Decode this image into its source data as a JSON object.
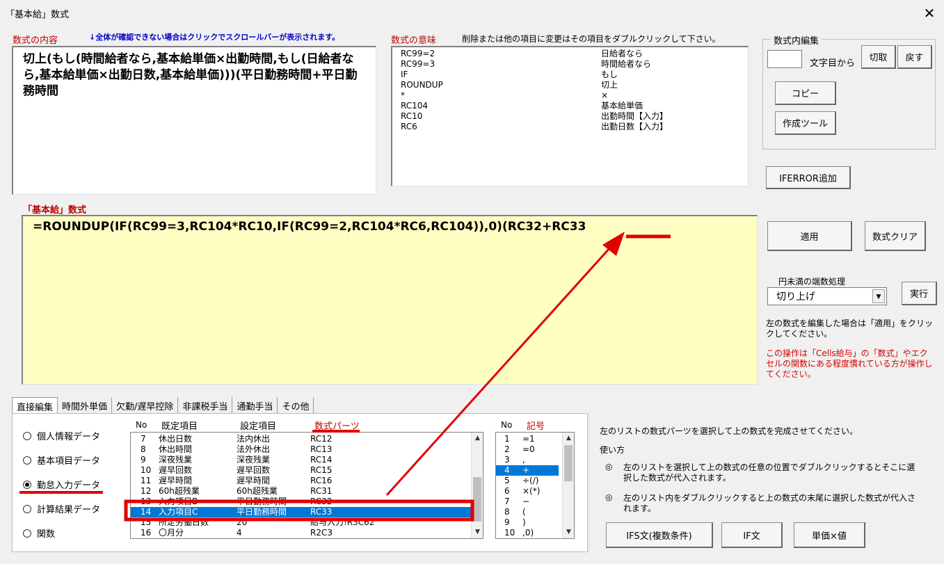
{
  "window": {
    "title": "「基本給」数式"
  },
  "content_section": {
    "label": "数式の内容",
    "note": "↓全体が確認できない場合はクリックでスクロールバーが表示されます。",
    "text": "切上(もし(時間給者なら,基本給単価×出勤時間,もし(日給者なら,基本給単価×出勤日数,基本給単価)))(平日勤務時間+平日勤務時間"
  },
  "meaning_section": {
    "label": "数式の意味",
    "note": "削除または他の項目に変更はその項目をダブルクリックして下さい。",
    "rows": [
      {
        "code": "RC99=2",
        "meaning": "日給者なら"
      },
      {
        "code": "RC99=3",
        "meaning": "時間給者なら"
      },
      {
        "code": "IF",
        "meaning": "もし"
      },
      {
        "code": "ROUNDUP",
        "meaning": "切上"
      },
      {
        "code": "*",
        "meaning": "×"
      },
      {
        "code": "RC104",
        "meaning": "基本給単価"
      },
      {
        "code": "RC10",
        "meaning": "出勤時間【入力】"
      },
      {
        "code": "RC6",
        "meaning": "出勤日数【入力】"
      }
    ]
  },
  "edit_group": {
    "legend": "数式内編集",
    "position_value": "",
    "position_suffix": "文字目から",
    "cut_label": "切取",
    "undo_label": "戻す",
    "copy_label": "コピー",
    "tool_label": "作成ツール"
  },
  "iferror_label": "IFERROR追加",
  "formula_section": {
    "label": "「基本給」数式",
    "text": "=ROUNDUP(IF(RC99=3,RC104*RC10,IF(RC99=2,RC104*RC6,RC104)),0)(RC32+RC33"
  },
  "apply_label": "適用",
  "clear_label": "数式クリア",
  "rounding": {
    "label": "円未満の端数処理",
    "selected": "切り上げ",
    "run_label": "実行"
  },
  "help_text": "左の数式を編集した場合は「適用」をクリックしてください。",
  "warning_text": "この操作は「Cells給与」の「数式」やエクセルの関数にある程度慣れている方が操作してください。",
  "tabs": [
    "直接編集",
    "時間外単価",
    "欠勤/遅早控除",
    "非課税手当",
    "通勤手当",
    "その他"
  ],
  "radios": [
    {
      "label": "個人情報データ",
      "checked": false
    },
    {
      "label": "基本項目データ",
      "checked": false
    },
    {
      "label": "勤怠入力データ",
      "checked": true
    },
    {
      "label": "計算結果データ",
      "checked": false
    },
    {
      "label": "関数",
      "checked": false
    }
  ],
  "parts_list": {
    "headers": {
      "no": "No",
      "default_item": "既定項目",
      "setting_item": "設定項目",
      "parts": "数式パーツ"
    },
    "rows": [
      {
        "no": "7",
        "def": "休出日数",
        "set": "法内休出",
        "part": "RC12"
      },
      {
        "no": "8",
        "def": "休出時間",
        "set": "法外休出",
        "part": "RC13"
      },
      {
        "no": "9",
        "def": "深夜残業",
        "set": "深夜残業",
        "part": "RC14"
      },
      {
        "no": "10",
        "def": "遅早回数",
        "set": "遅早回数",
        "part": "RC15"
      },
      {
        "no": "11",
        "def": "遅早時間",
        "set": "遅早時間",
        "part": "RC16"
      },
      {
        "no": "12",
        "def": "60h超残業",
        "set": "60h超残業",
        "part": "RC31"
      },
      {
        "no": "13",
        "def": "入力項目B",
        "set": "平日勤務時間",
        "part": "RC32"
      },
      {
        "no": "14",
        "def": "入力項目C",
        "set": "平日勤務時間",
        "part": "RC33"
      },
      {
        "no": "15",
        "def": "所定労働日数",
        "set": "20",
        "part": "給与入力!R3C62"
      },
      {
        "no": "16",
        "def": "〇月分",
        "set": "4",
        "part": "R2C3"
      }
    ],
    "selected_index": 7
  },
  "symbol_list": {
    "headers": {
      "no": "No",
      "symbol": "記号"
    },
    "rows": [
      {
        "no": "1",
        "sym": "=1"
      },
      {
        "no": "2",
        "sym": "=0"
      },
      {
        "no": "3",
        "sym": ","
      },
      {
        "no": "4",
        "sym": "+"
      },
      {
        "no": "5",
        "sym": "÷(/)"
      },
      {
        "no": "6",
        "sym": "×(*)"
      },
      {
        "no": "7",
        "sym": "−"
      },
      {
        "no": "8",
        "sym": "("
      },
      {
        "no": "9",
        "sym": ")"
      },
      {
        "no": "10",
        "sym": ",0)"
      }
    ],
    "selected_index": 3
  },
  "instructions": {
    "intro": "左のリストの数式パーツを選択して上の数式を完成させてください。",
    "usage_label": "使い方",
    "item1": "左のリストを選択して上の数式の任意の位置でダブルクリックするとそこに選択した数式が代入されます。",
    "item2": "左のリスト内をダブルクリックすると上の数式の末尾に選択した数式が代入されます。",
    "bullet": "◎"
  },
  "bottom_buttons": {
    "ifs": "IFS文(複数条件)",
    "if": "IF文",
    "unit": "単価×値"
  },
  "colors": {
    "annotation_red": "#e00000",
    "selection_blue": "#0078d7",
    "formula_bg": "#ffffc4"
  }
}
